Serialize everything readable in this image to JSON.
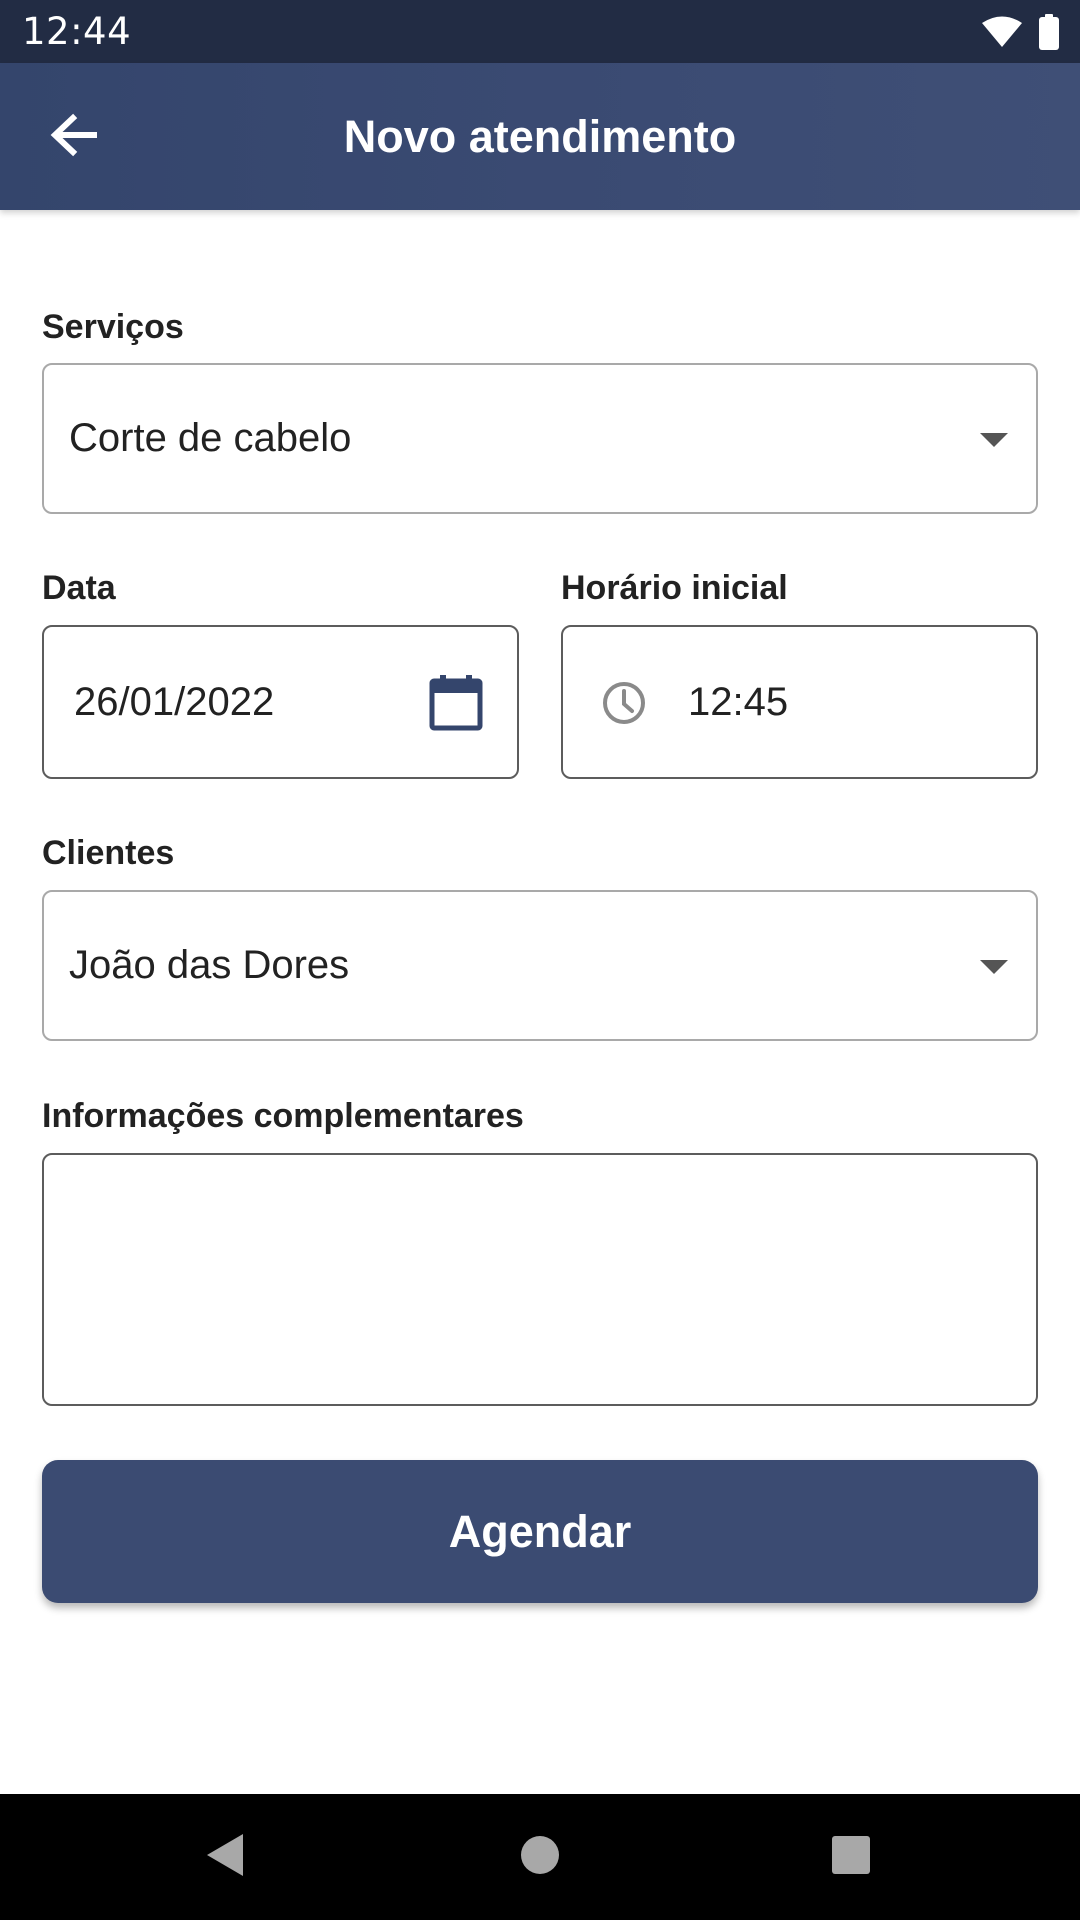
{
  "status_bar": {
    "time": "12:44",
    "icons": [
      "wifi-icon",
      "battery-icon"
    ]
  },
  "app_bar": {
    "title": "Novo atendimento",
    "back_icon": "arrow-left-icon"
  },
  "form": {
    "services": {
      "label": "Serviços",
      "selected": "Corte de cabelo"
    },
    "date": {
      "label": "Data",
      "value": "26/01/2022",
      "icon": "calendar-icon"
    },
    "start_time": {
      "label": "Horário inicial",
      "value": "12:45",
      "icon": "clock-icon"
    },
    "clients": {
      "label": "Clientes",
      "selected": "João das Dores"
    },
    "notes": {
      "label": "Informações complementares",
      "value": ""
    },
    "submit_label": "Agendar"
  },
  "nav_bar": {
    "icons": [
      "back-triangle-icon",
      "home-circle-icon",
      "recents-square-icon"
    ]
  },
  "colors": {
    "status_bar": "#222c44",
    "app_bar": "#3b4b73",
    "accent": "#3b4b72",
    "icon_calendar": "#34456c",
    "icon_clock": "#8a8a8a"
  }
}
